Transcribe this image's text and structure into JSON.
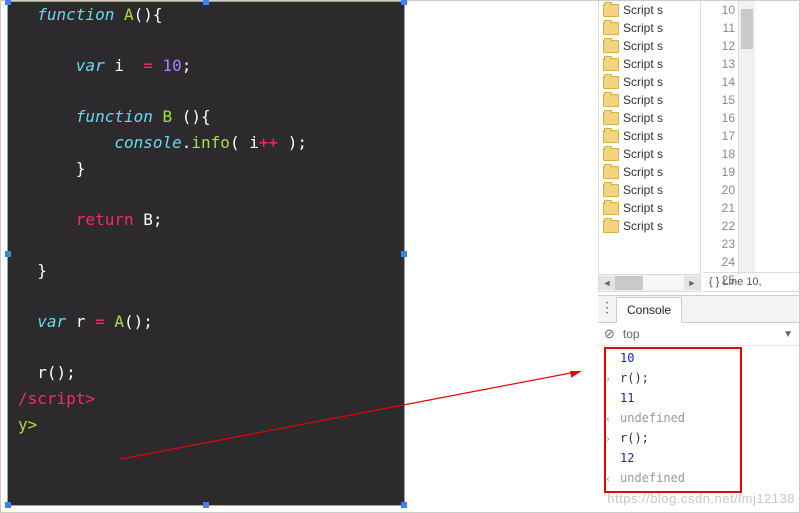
{
  "code": {
    "l1": "function",
    "l1n": " A",
    "l1p": "(){",
    "l2": "",
    "l3k": "var",
    "l3i": " i  ",
    "l3o": "=",
    "l3v": " 10",
    "l3e": ";",
    "l5k": "function",
    "l5n": " B ",
    "l5p": "(){",
    "l6o": "console",
    "l6d": ".",
    "l6m": "info",
    "l6a": "( i",
    "l6op": "++ ",
    "l6e": ");",
    "l7": "}",
    "l9k": "return",
    "l9v": " B",
    "l9e": ";",
    "l11": "}",
    "l13k": "var",
    "l13i": " r ",
    "l13o": "=",
    "l13c": " A",
    "l13p": "()",
    "l13e": ";",
    "l15c": "r",
    "l15p": "()",
    "l15e": ";",
    "tag_close": "/script>",
    "y_close": "y>"
  },
  "files": {
    "items": [
      {
        "label": "Script s"
      },
      {
        "label": "Script s"
      },
      {
        "label": "Script s"
      },
      {
        "label": "Script s"
      },
      {
        "label": "Script s"
      },
      {
        "label": "Script s"
      },
      {
        "label": "Script s"
      },
      {
        "label": "Script s"
      },
      {
        "label": "Script s"
      },
      {
        "label": "Script s"
      },
      {
        "label": "Script s"
      },
      {
        "label": "Script s"
      },
      {
        "label": "Script s"
      }
    ]
  },
  "gutter": [
    "10",
    "11",
    "12",
    "13",
    "14",
    "15",
    "16",
    "17",
    "18",
    "19",
    "20",
    "21",
    "22",
    "23",
    "24",
    "25"
  ],
  "status": {
    "pos": "{ }   Line 10,"
  },
  "console": {
    "tab": "Console",
    "scope": "top",
    "lines": [
      {
        "glyph": "",
        "text": "10",
        "cls": "numv"
      },
      {
        "glyph": "›",
        "text": "r();",
        "cls": "txt"
      },
      {
        "glyph": "",
        "text": "11",
        "cls": "numv"
      },
      {
        "glyph": "‹",
        "text": "undefined",
        "cls": "und"
      },
      {
        "glyph": "›",
        "text": "r();",
        "cls": "txt"
      },
      {
        "glyph": "",
        "text": "12",
        "cls": "numv"
      },
      {
        "glyph": "‹",
        "text": "undefined",
        "cls": "und"
      }
    ]
  },
  "watermark": "https://blog.csdn.net/lmj12138"
}
